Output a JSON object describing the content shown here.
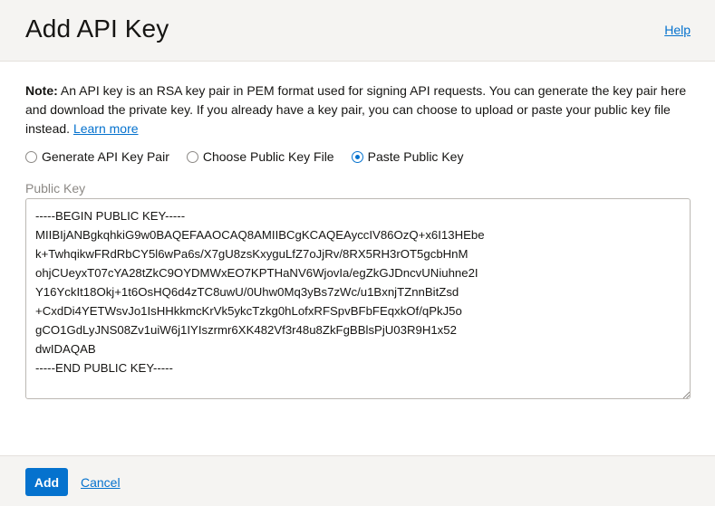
{
  "dialog": {
    "title": "Add API Key",
    "help_label": "Help"
  },
  "note": {
    "label": "Note:",
    "text": " An API key is an RSA key pair in PEM format used for signing API requests. You can generate the key pair here and download the private key. If you already have a key pair, you can choose to upload or paste your public key file instead. ",
    "learn_more": "Learn more"
  },
  "key_options": {
    "selected": "Paste Public Key",
    "items": [
      {
        "label": "Generate API Key Pair",
        "checked": false
      },
      {
        "label": "Choose Public Key File",
        "checked": false
      },
      {
        "label": "Paste Public Key",
        "checked": true
      }
    ]
  },
  "public_key": {
    "label": "Public Key",
    "value": "-----BEGIN PUBLIC KEY-----\nMIIBIjANBgkqhkiG9w0BAQEFAAOCAQ8AMIIBCgKCAQEAyccIV86OzQ+x6I13HEbe\nk+TwhqikwFRdRbCY5l6wPa6s/X7gU8zsKxyguLfZ7oJjRv/8RX5RH3rOT5gcbHnM\nohjCUeyxT07cYA28tZkC9OYDMWxEO7KPTHaNV6WjovIa/egZkGJDncvUNiuhne2I\nY16YckIt18Okj+1t6OsHQ6d4zTC8uwU/0Uhw0Mq3yBs7zWc/u1BxnjTZnnBitZsd\n+CxdDi4YETWsvJo1IsHHkkmcKrVk5ykcTzkg0hLofxRFSpvBFbFEqxkOf/qPkJ5o\ngCO1GdLyJNS08Zv1uiW6j1IYIszrmr6XK482Vf3r48u8ZkFgBBlsPjU03R9H1x52\ndwIDAQAB\n-----END PUBLIC KEY-----"
  },
  "footer": {
    "add_label": "Add",
    "cancel_label": "Cancel"
  },
  "colors": {
    "accent": "#0572ce",
    "header_bg": "#f5f4f2",
    "border": "#bcb8b3"
  },
  "icons": {
    "radio": "radio-button-icon",
    "resize": "resize-grip-icon"
  }
}
